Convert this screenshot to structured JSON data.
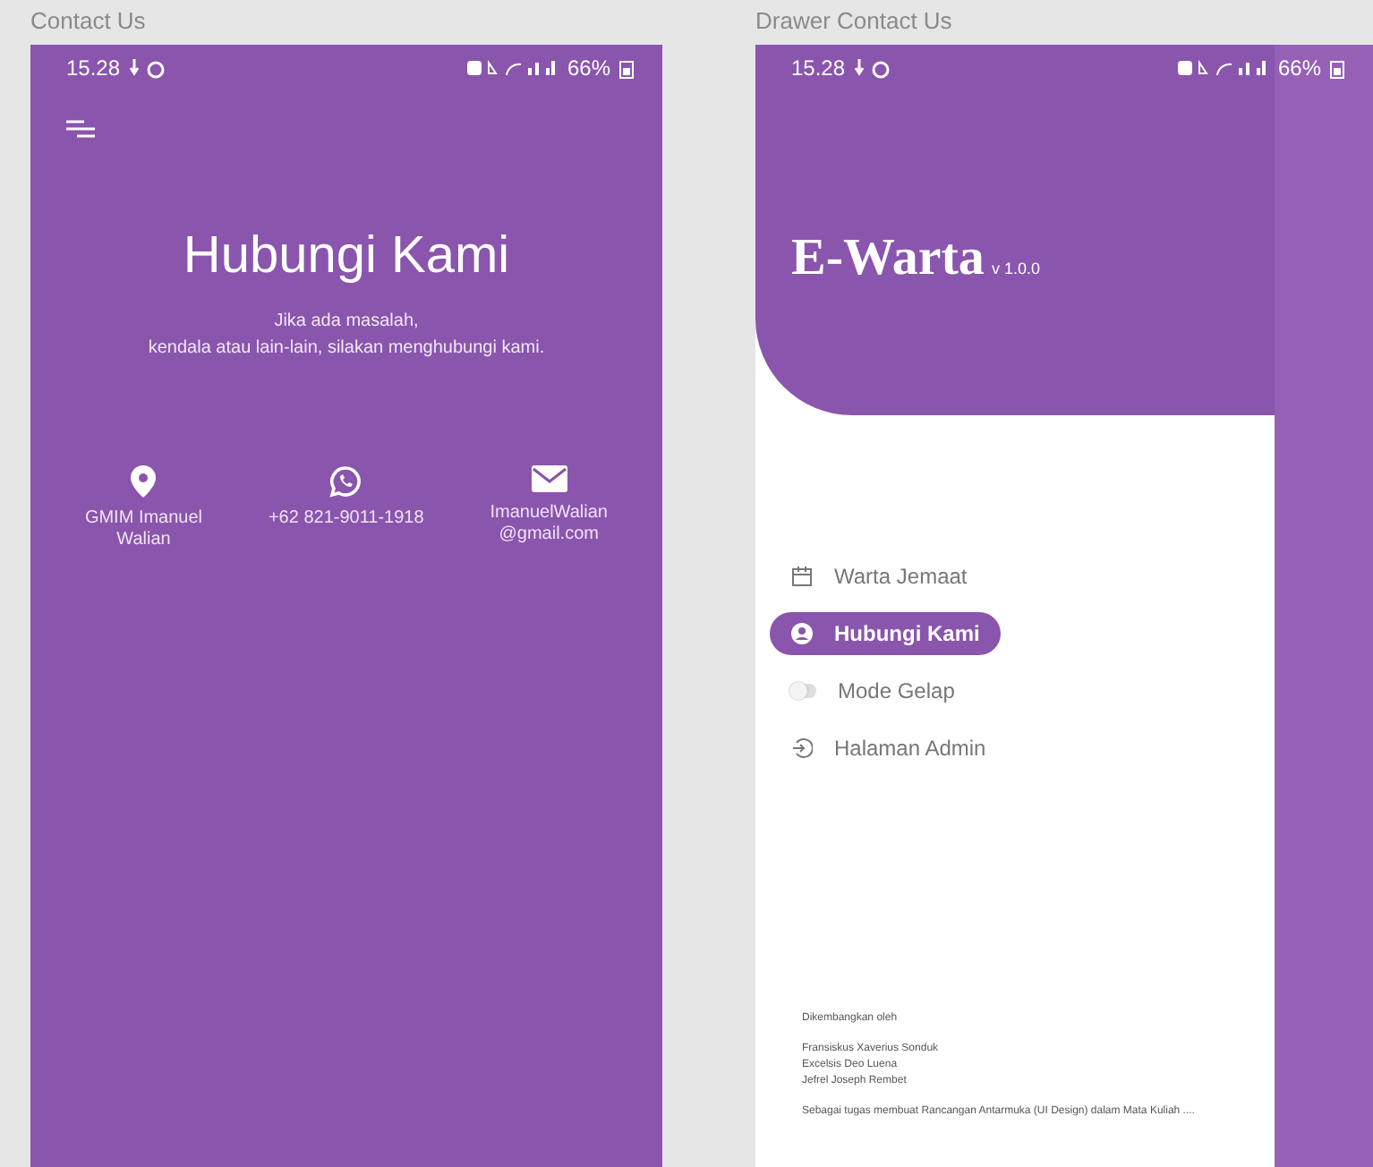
{
  "screens": [
    {
      "kind": "contact",
      "label": "Contact Us",
      "status": {
        "time": "15.28",
        "battery": "66%"
      },
      "title": "Hubungi Kami",
      "subtitle_lines": [
        "Jika ada masalah,",
        "kendala atau lain-lain, silakan menghubungi kami."
      ],
      "contacts": [
        {
          "kind": "location",
          "text_lines": [
            "GMIM Imanuel",
            "Walian"
          ]
        },
        {
          "kind": "whatsapp",
          "text_lines": [
            "+62 821-9011-1918"
          ]
        },
        {
          "kind": "email",
          "text_lines": [
            "ImanuelWalian",
            "@gmail.com"
          ]
        }
      ]
    },
    {
      "kind": "drawer",
      "label": "Drawer Contact Us",
      "status": {
        "time": "15.28",
        "battery": "66%"
      },
      "app_name": "E-Warta",
      "version": "v 1.0.0",
      "menu": [
        {
          "kind": "calendar",
          "label": "Warta Jemaat",
          "selected": false
        },
        {
          "kind": "person",
          "label": "Hubungi Kami",
          "selected": true
        },
        {
          "kind": "toggle",
          "label": "Mode Gelap",
          "selected": false,
          "on": false
        },
        {
          "kind": "login",
          "label": "Halaman Admin",
          "selected": false
        }
      ],
      "credits_heading": "Dikembangkan oleh",
      "credits_names": [
        "Fransiskus Xaverius Sonduk",
        "Excelsis Deo Luena",
        "Jefrel Joseph Rembet"
      ],
      "credits_note": "Sebagai tugas membuat Rancangan Antarmuka (UI Design) dalam Mata Kuliah ...."
    }
  ]
}
